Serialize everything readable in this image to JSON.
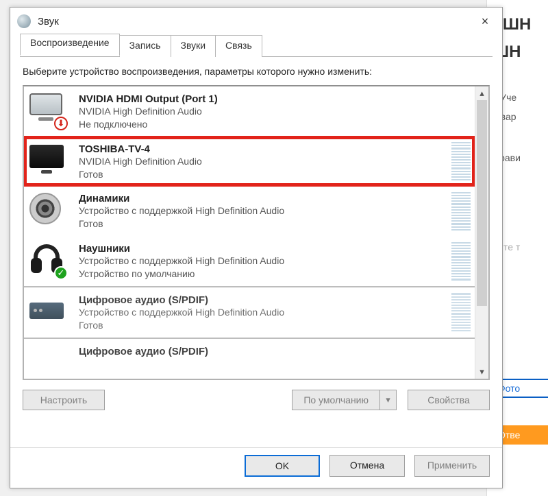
{
  "window": {
    "title": "Звук",
    "close_icon": "×"
  },
  "tabs": {
    "playback": "Воспроизведение",
    "recording": "Запись",
    "sounds": "Звуки",
    "communications": "Связь"
  },
  "instruction": "Выберите устройство воспроизведения, параметры которого нужно изменить:",
  "devices": [
    {
      "name": "NVIDIA HDMI Output (Port 1)",
      "controller": "NVIDIA High Definition Audio",
      "status": "Не подключено",
      "icon": "monitor",
      "badge": "down",
      "meter": false
    },
    {
      "name": "TOSHIBA-TV-4",
      "controller": "NVIDIA High Definition Audio",
      "status": "Готов",
      "icon": "tv",
      "badge": "",
      "meter": true,
      "highlight": true
    },
    {
      "name": "Динамики",
      "controller": "Устройство с поддержкой High Definition Audio",
      "status": "Готов",
      "icon": "speaker",
      "badge": "",
      "meter": true
    },
    {
      "name": "Наушники",
      "controller": "Устройство с поддержкой High Definition Audio",
      "status": "Устройство по умолчанию",
      "icon": "headphones",
      "badge": "check",
      "meter": true
    },
    {
      "name": "Цифровое аудио (S/PDIF)",
      "controller": "Устройство с поддержкой High Definition Audio",
      "status": "Готов",
      "icon": "spdif",
      "badge": "",
      "meter": true,
      "cutTop": true
    },
    {
      "name": "Цифровое аудио (S/PDIF)",
      "controller": "",
      "status": "",
      "icon": "",
      "badge": "",
      "meter": false,
      "cutTop": true
    }
  ],
  "panel_buttons": {
    "configure": "Настроить",
    "set_default": "По умолчанию",
    "properties": "Свойства"
  },
  "dialog_buttons": {
    "ok": "OK",
    "cancel": "Отмена",
    "apply": "Применить"
  },
  "backdrop": {
    "l1": "УШН",
    "l2": "ШН",
    "l3": "ь Уче",
    "l4": "е вар",
    "l5": "Нрави",
    "l6": "дите т",
    "photo": "Фото",
    "answer": "Отве"
  }
}
